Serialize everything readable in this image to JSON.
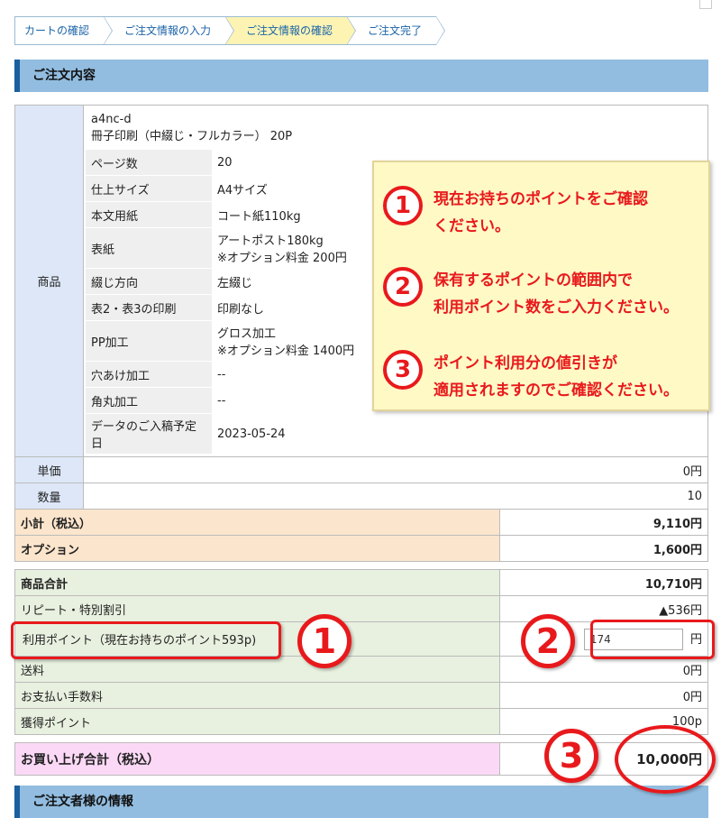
{
  "steps": [
    "カートの確認",
    "ご注文情報の入力",
    "ご注文情報の確認",
    "ご注文完了"
  ],
  "section_order": "ご注文内容",
  "section_customer": "ご注文者様の情報",
  "product": {
    "label": "商品",
    "code": "a4nc-d",
    "name": "冊子印刷（中綴じ・フルカラー） 20P",
    "specs": [
      {
        "key": "ページ数",
        "value": "20",
        "note": ""
      },
      {
        "key": "仕上サイズ",
        "value": "A4サイズ",
        "note": ""
      },
      {
        "key": "本文用紙",
        "value": "コート紙110kg",
        "note": ""
      },
      {
        "key": "表紙",
        "value": "アートポスト180kg",
        "note": "※オプション料金 200円"
      },
      {
        "key": "綴じ方向",
        "value": "左綴じ",
        "note": ""
      },
      {
        "key": "表2・表3の印刷",
        "value": "印刷なし",
        "note": ""
      },
      {
        "key": "PP加工",
        "value": "グロス加工",
        "note": "※オプション料金 1400円"
      },
      {
        "key": "穴あけ加工",
        "value": "--",
        "note": ""
      },
      {
        "key": "角丸加工",
        "value": "--",
        "note": ""
      },
      {
        "key": "データのご入稿予定日",
        "value": "2023-05-24",
        "note": ""
      }
    ]
  },
  "unit_price": {
    "label": "単価",
    "value": "0円"
  },
  "quantity": {
    "label": "数量",
    "value": "10"
  },
  "subtotal": {
    "label": "小計（税込）",
    "value": "9,110円"
  },
  "option": {
    "label": "オプション",
    "value": "1,600円"
  },
  "goods_total": {
    "label": "商品合計",
    "value": "10,710円"
  },
  "discount": {
    "label": "リピート・特別割引",
    "value": "▲536円"
  },
  "points": {
    "label": "利用ポイント（現在お持ちのポイント593p)",
    "input_value": "174",
    "unit": "円"
  },
  "shipping": {
    "label": "送料",
    "value": "0円"
  },
  "fee": {
    "label": "お支払い手数料",
    "value": "0円"
  },
  "earned": {
    "label": "獲得ポイント",
    "value": "100p"
  },
  "grand_total": {
    "label": "お買い上げ合計（税込）",
    "value": "10,000円"
  },
  "callout": [
    {
      "num": "1",
      "line1": "現在お持ちのポイントをご確認",
      "line2": "ください。"
    },
    {
      "num": "2",
      "line1": "保有するポイントの範囲内で",
      "line2": "利用ポイント数をご入力ください。"
    },
    {
      "num": "3",
      "line1": "ポイント利用分の値引きが",
      "line2": "適用されますのでご確認ください。"
    }
  ],
  "marker_nums": [
    "1",
    "2",
    "3"
  ],
  "colors": {
    "accent_red": "#e8191c",
    "header_blue": "#92bde0",
    "active_step": "#fdf4b4"
  }
}
